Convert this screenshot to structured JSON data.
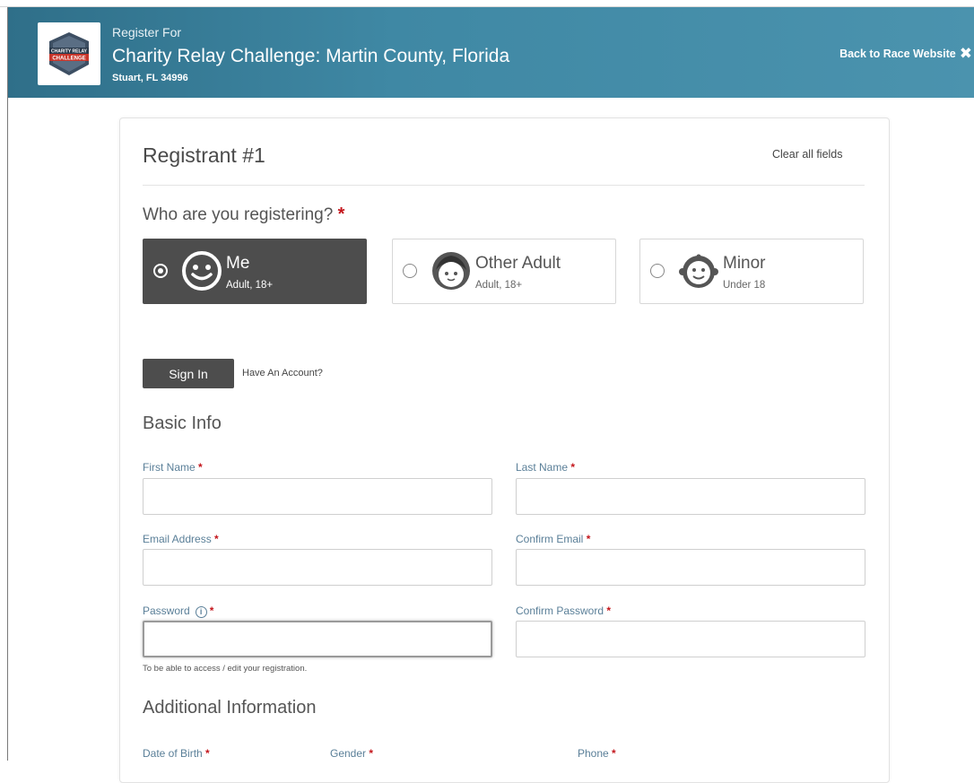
{
  "header": {
    "subtitle": "Register For",
    "title": "Charity Relay Challenge: Martin County, Florida",
    "location": "Stuart, FL 34996",
    "back_label": "Back to Race Website",
    "logo_text": [
      "CHARITY RELAY",
      "CHALLENGE"
    ]
  },
  "registrant": {
    "title": "Registrant #1",
    "clear_label": "Clear all fields"
  },
  "who": {
    "question": "Who are you registering?",
    "required_mark": "*",
    "options": [
      {
        "title": "Me",
        "subtitle": "Adult, 18+",
        "selected": true,
        "icon": "smiley-face-icon"
      },
      {
        "title": "Other Adult",
        "subtitle": "Adult, 18+",
        "selected": false,
        "icon": "adult-face-icon"
      },
      {
        "title": "Minor",
        "subtitle": "Under 18",
        "selected": false,
        "icon": "baby-face-icon"
      }
    ]
  },
  "account": {
    "sign_in_label": "Sign In",
    "have_account_label": "Have An Account?"
  },
  "basic_info": {
    "title": "Basic Info",
    "fields": {
      "first_name": {
        "label": "First Name",
        "value": ""
      },
      "last_name": {
        "label": "Last Name",
        "value": ""
      },
      "email": {
        "label": "Email Address",
        "value": ""
      },
      "confirm_email": {
        "label": "Confirm Email",
        "value": ""
      },
      "password": {
        "label": "Password",
        "value": ""
      },
      "confirm_password": {
        "label": "Confirm Password",
        "value": ""
      }
    },
    "password_hint": "To be able to access / edit your registration."
  },
  "additional": {
    "title": "Additional Information",
    "fields": {
      "dob": "Date of Birth",
      "gender": "Gender",
      "phone": "Phone"
    }
  },
  "colors": {
    "header": "#3f88a4",
    "selected_option": "#4d4d4d",
    "required": "#c4161c",
    "field_label": "#5a7f98"
  }
}
